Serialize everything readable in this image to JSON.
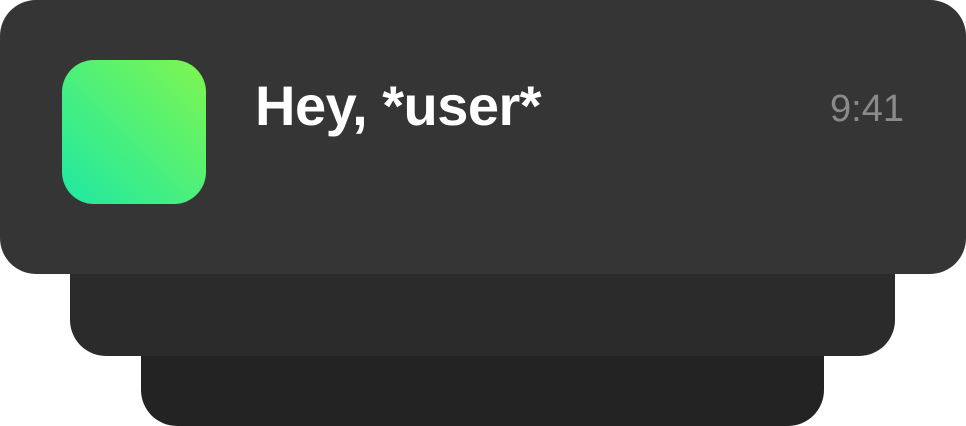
{
  "notification": {
    "title": "Hey, *user*",
    "time": "9:41",
    "icon": "app-icon"
  },
  "colors": {
    "card_front": "#353535",
    "card_middle": "#2b2b2b",
    "card_back": "#232323",
    "icon_gradient_start": "#1ee8a3",
    "icon_gradient_end": "#7ff54f",
    "title_text": "#ffffff",
    "time_text": "#8a8a8a"
  }
}
